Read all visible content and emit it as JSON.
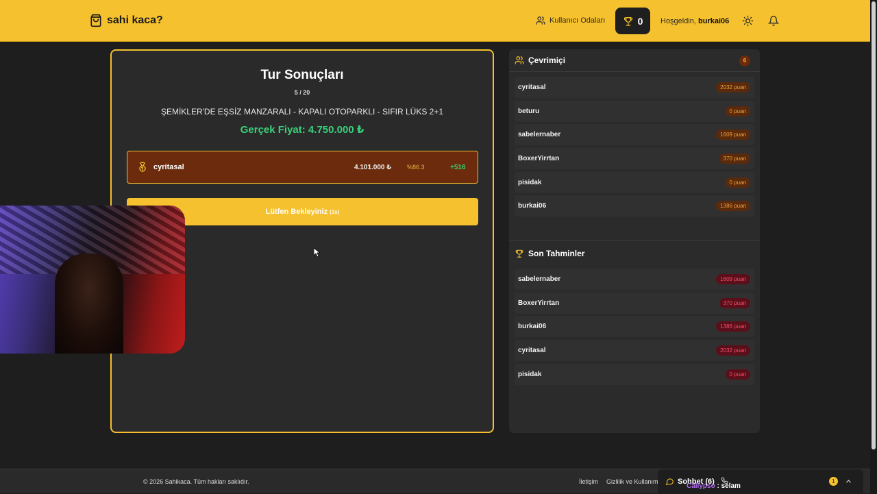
{
  "header": {
    "brand": "sahi kaca?",
    "brand_icon": "shopping-bag-icon",
    "rooms_label": "Kullanıcı Odaları",
    "trophy_count": "0",
    "welcome_prefix": "Hoşgeldin,",
    "username": "burkai06"
  },
  "game": {
    "title": "Tur Sonuçları",
    "round": "5 / 20",
    "listing_title": "ŞEMİKLER'DE EŞSİZ MANZARALI - KAPALI OTOPARKLI - SIFIR LÜKS 2+1",
    "real_price": "Gerçek Fiyat: 4.750.000 ₺",
    "result": {
      "name": "cyritasal",
      "guess": "4.101.000 ₺",
      "accuracy": "%86.3",
      "points": "+516"
    },
    "wait_label": "Lütfen Bekleyiniz",
    "wait_countdown": "(3s)"
  },
  "online": {
    "title": "Çevrimiçi",
    "count": "6",
    "players": [
      {
        "name": "cyritasal",
        "score": "2032 puan"
      },
      {
        "name": "beturu",
        "score": "0 puan"
      },
      {
        "name": "sabelernaber",
        "score": "1609 puan"
      },
      {
        "name": "BoxerYirrtan",
        "score": "370 puan"
      },
      {
        "name": "pisidak",
        "score": "0 puan"
      },
      {
        "name": "burkai06",
        "score": "1386 puan"
      }
    ]
  },
  "recent": {
    "title": "Son Tahminler",
    "players": [
      {
        "name": "sabelernaber",
        "score": "1609 puan"
      },
      {
        "name": "BoxerYirrtan",
        "score": "370 puan"
      },
      {
        "name": "burkai06",
        "score": "1386 puan"
      },
      {
        "name": "cyritasal",
        "score": "2032 puan"
      },
      {
        "name": "pisidak",
        "score": "0 puan"
      }
    ]
  },
  "footer": {
    "copyright": "© 2026 Sahikaca. Tüm hakları saklıdır.",
    "link_contact": "İletişim",
    "link_privacy": "Gizlilik ve Kullanım"
  },
  "chat": {
    "title": "Sohbet (6)",
    "last_user": "Callypso",
    "last_sep": " : ",
    "last_text": "selam",
    "unread": "1"
  },
  "colors": {
    "accent": "#f6c12e",
    "positive": "#39d17a",
    "background": "#1e1e1e"
  }
}
